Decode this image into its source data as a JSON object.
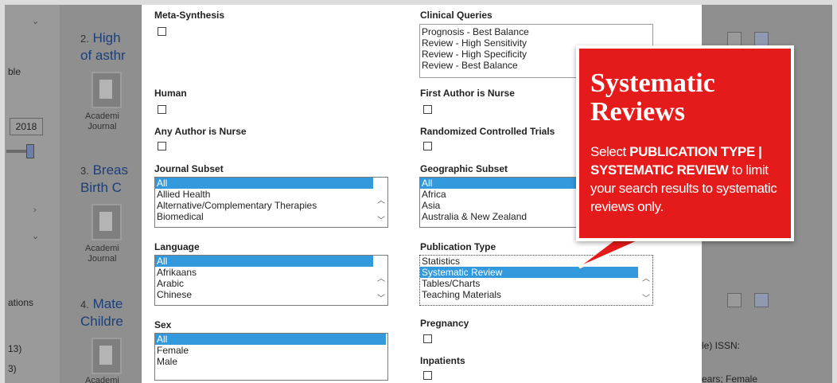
{
  "background": {
    "left": {
      "rows": [
        "ble",
        "2018",
        "ations",
        "13)",
        "3)"
      ]
    },
    "results": [
      {
        "num": "2.",
        "title_line1": "High",
        "title_line2": "of asthr",
        "type1": "Academi",
        "type2": "Journal"
      },
      {
        "num": "3.",
        "title_line1": "Breas",
        "title_line2": "Birth C",
        "type1": "Academi",
        "type2": "Journal"
      },
      {
        "num": "4.",
        "title_line1": "Mate",
        "title_line2": "Childre",
        "type1": "Academi",
        "type2": ""
      }
    ],
    "right": {
      "text1": "cle) ISSN:",
      "text2": "years; Female"
    }
  },
  "modal": {
    "meta_synthesis": {
      "label": "Meta-Synthesis"
    },
    "clinical_queries": {
      "label": "Clinical Queries",
      "options": [
        "Prognosis - Best Balance",
        "Review - High Sensitivity",
        "Review - High Specificity",
        "Review - Best Balance"
      ]
    },
    "human": {
      "label": "Human"
    },
    "first_author_nurse": {
      "label": "First Author is Nurse"
    },
    "any_author_nurse": {
      "label": "Any Author is Nurse"
    },
    "rct": {
      "label": "Randomized Controlled Trials"
    },
    "journal_subset": {
      "label": "Journal Subset",
      "options": [
        "All",
        "Allied Health",
        "Alternative/Complementary Therapies",
        "Biomedical"
      ],
      "selected": "All"
    },
    "geographic_subset": {
      "label": "Geographic Subset",
      "options": [
        "All",
        "Africa",
        "Asia",
        "Australia & New Zealand"
      ],
      "selected": "All"
    },
    "language": {
      "label": "Language",
      "options": [
        "All",
        "Afrikaans",
        "Arabic",
        "Chinese"
      ],
      "selected": "All"
    },
    "publication_type": {
      "label": "Publication Type",
      "options": [
        "Statistics",
        "Systematic Review",
        "Tables/Charts",
        "Teaching Materials"
      ],
      "selected": "Systematic Review"
    },
    "sex": {
      "label": "Sex",
      "options": [
        "All",
        "Female",
        "Male"
      ],
      "selected": "All"
    },
    "pregnancy": {
      "label": "Pregnancy"
    },
    "inpatients": {
      "label": "Inpatients"
    }
  },
  "callout": {
    "title_line1": "Systematic",
    "title_line2": "Reviews",
    "body_part1": "Select ",
    "body_bold": "PUBLICATION TYPE | SYSTEMATIC REVIEW",
    "body_part2": " to limit your search results to systematic reviews only.",
    "color": "#e51b1b"
  }
}
